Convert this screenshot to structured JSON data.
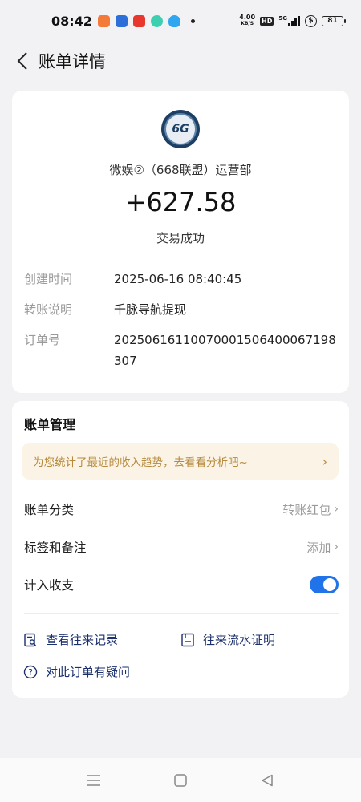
{
  "status_bar": {
    "time": "08:42",
    "net_speed_value": "4.00",
    "net_speed_unit": "KB/S",
    "hd": "HD",
    "signal": "5G",
    "battery": "81"
  },
  "header": {
    "title": "账单详情"
  },
  "transaction": {
    "merchant_logo_text": "6G",
    "merchant": "微娱②（668联盟）运营部",
    "amount": "+627.58",
    "status": "交易成功",
    "details": [
      {
        "label": "创建时间",
        "value": "2025-06-16 08:40:45"
      },
      {
        "label": "转账说明",
        "value": "千脉导航提现"
      },
      {
        "label": "订单号",
        "value": "20250616110070001506400067198307"
      }
    ]
  },
  "manage": {
    "title": "账单管理",
    "banner": "为您统计了最近的收入趋势，去看看分析吧~",
    "category_label": "账单分类",
    "category_value": "转账红包",
    "tags_label": "标签和备注",
    "tags_value": "添加",
    "include_label": "计入收支",
    "include_on": true,
    "actions": {
      "history": "查看往来记录",
      "proof": "往来流水证明",
      "question": "对此订单有疑问"
    }
  },
  "colors": {
    "accent_blue": "#2173e9",
    "banner_bg": "#fbf4e6",
    "banner_text": "#b68a3e",
    "action_text": "#1a2f6b"
  }
}
